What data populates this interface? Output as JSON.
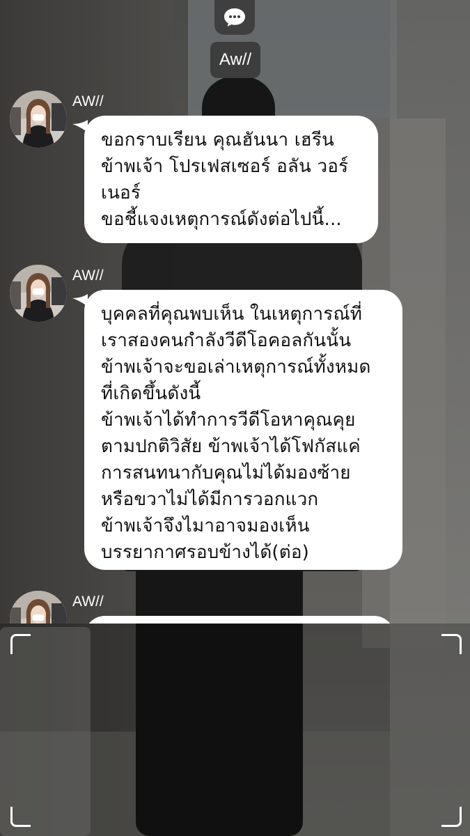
{
  "header": {
    "chat_icon": "chat-bubble-icon",
    "title": "Aw//"
  },
  "messages": [
    {
      "sender": "AW//",
      "text": "ขอกราบเรียน คุณฮันนา เฮรีน\nข้าพเจ้า โปรเฟสเซอร์ อลัน วอร์\nเนอร์\nขอชี้แจงเหตุการณ์ดังต่อไปนี้..."
    },
    {
      "sender": "AW//",
      "text": "บุคคลที่คุณพบเห็น ในเหตุการณ์ที่\nเราสองคนกำลังวีดีโอคอลกันนั้น\nข้าพเจ้าจะขอเล่าเหตุการณ์ทั้งหมด\nที่เกิดขึ้นดังนี้\nข้าพเจ้าได้ทำการวีดีโอหาคุณคุย\nตามปกติวิสัย ข้าพเจ้าได้โฟกัสแค่\nการสนทนากับคุณไม่ได้มองซ้าย\nหรือขวาไม่ได้มีการวอกแวก\nข้าพเจ้าจึงไมาอาจมองเห็น\nบรรยากาศรอบข้างได้(ต่อ)"
    },
    {
      "sender": "AW//",
      "text": ""
    }
  ],
  "colors": {
    "bubble": "#ffffff",
    "header_bg": "#3d3d3d",
    "text": "#111111"
  }
}
